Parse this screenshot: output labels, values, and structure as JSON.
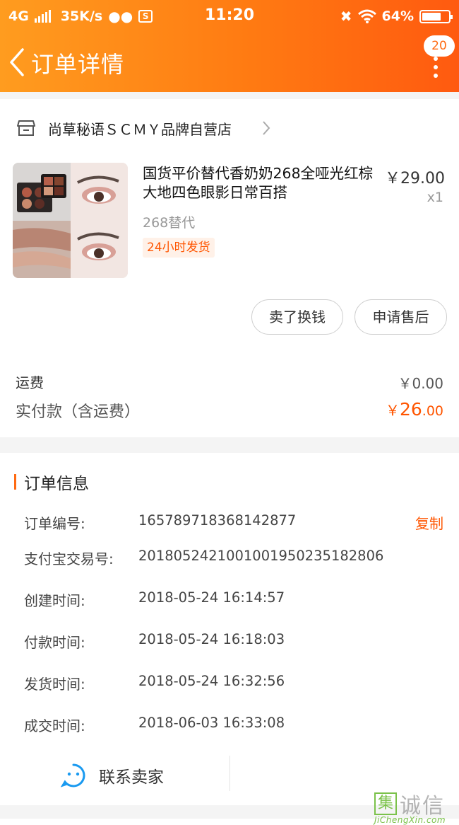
{
  "status_bar": {
    "network": "4G",
    "speed": "35K/s",
    "time": "11:20",
    "battery": "64%"
  },
  "nav": {
    "title": "订单详情",
    "badge": "20"
  },
  "shop": {
    "name": "尚草秘语ＳＣＭＹ品牌自营店"
  },
  "product": {
    "title": "国货平价替代香奶奶268全哑光红棕大地四色眼影日常百搭",
    "price": "￥29.00",
    "quantity": "x1",
    "variant": "268替代",
    "tag": "24小时发货"
  },
  "actions": {
    "sell_label": "卖了换钱",
    "after_sale_label": "申请售后"
  },
  "totals": {
    "shipping_label": "运费",
    "shipping_value": "￥0.00",
    "paid_label": "实付款（含运费）",
    "paid_currency": "￥",
    "paid_int": "26",
    "paid_dec": ".00"
  },
  "order_info": {
    "title": "订单信息",
    "copy_label": "复制",
    "rows": [
      {
        "label": "订单编号:",
        "value": "165789718368142877"
      },
      {
        "label": "支付宝交易号:",
        "value": "2018052421001001950235182806"
      },
      {
        "label": "创建时间:",
        "value": "2018-05-24 16:14:57"
      },
      {
        "label": "付款时间:",
        "value": "2018-05-24 16:18:03"
      },
      {
        "label": "发货时间:",
        "value": "2018-05-24 16:32:56"
      },
      {
        "label": "成交时间:",
        "value": "2018-06-03 16:33:08"
      }
    ]
  },
  "contact": {
    "label": "联系卖家"
  },
  "watermark": {
    "box_char": "集",
    "text": "诚信",
    "url": "JiChengXin.com"
  },
  "colors": {
    "accent": "#ff5500",
    "header_start": "#ff9c1f",
    "header_end": "#ff5a10"
  }
}
